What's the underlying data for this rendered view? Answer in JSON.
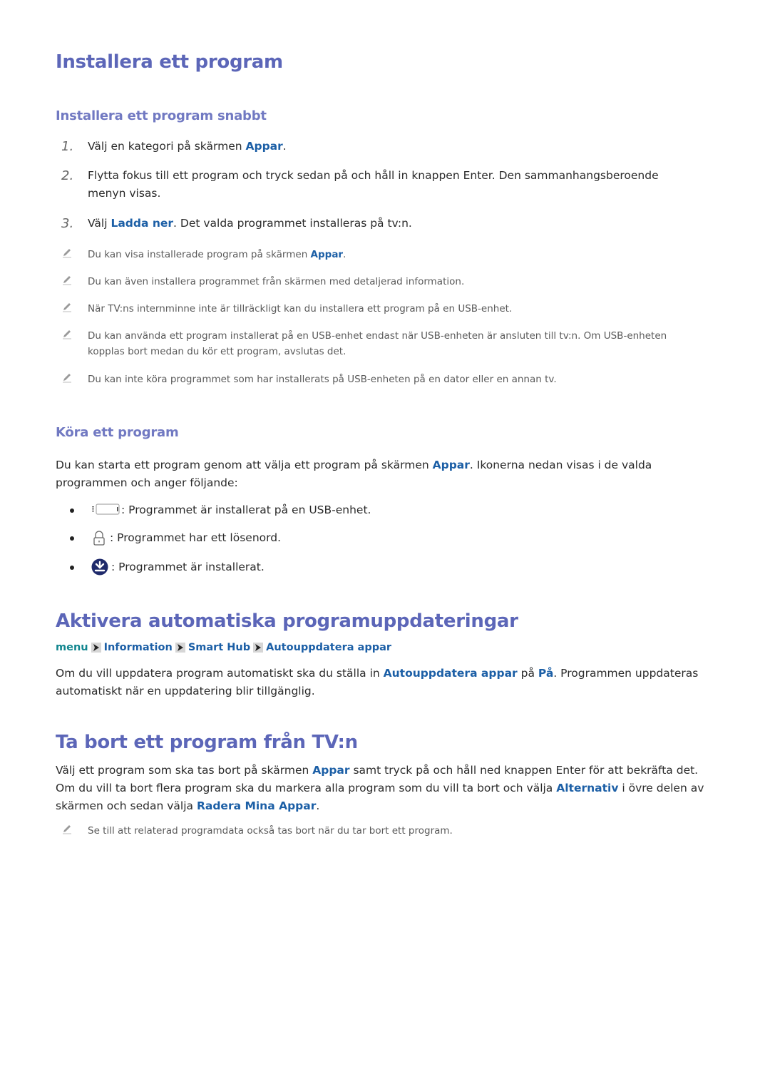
{
  "sections": {
    "install": {
      "title": "Installera ett program",
      "quick": {
        "title": "Installera ett program snabbt",
        "steps": [
          {
            "num": "1.",
            "pre": "Välj en kategori på skärmen ",
            "link": "Appar",
            "post": "."
          },
          {
            "num": "2.",
            "line1": "Flytta fokus till ett program och tryck sedan på och håll in knappen Enter. Den sammanhangsberoende",
            "line2": "menyn visas."
          },
          {
            "num": "3.",
            "pre": "Välj ",
            "link": "Ladda ner",
            "post": ". Det valda programmet installeras på tv:n."
          }
        ],
        "notes": [
          {
            "pre": "Du kan visa installerade program på skärmen ",
            "link": "Appar",
            "post": "."
          },
          {
            "text": "Du kan även installera programmet från skärmen med detaljerad information."
          },
          {
            "text": "När TV:ns internminne inte är tillräckligt kan du installera ett program på en USB-enhet."
          },
          {
            "line1": "Du kan använda ett program installerat på en USB-enhet endast när USB-enheten är ansluten till tv:n. Om USB-enheten",
            "line2": "kopplas bort medan du kör ett program, avslutas det."
          },
          {
            "text": "Du kan inte köra programmet som har installerats på USB-enheten på en dator eller en annan tv."
          }
        ]
      },
      "run": {
        "title": "Köra ett program",
        "para_pre": "Du kan starta ett program genom att välja ett program på skärmen ",
        "para_link": "Appar",
        "para_post": ". Ikonerna nedan visas i de valda",
        "para_line2": "programmen och anger följande:",
        "bullets": [
          {
            "icon": "usb-device-icon",
            "text": ": Programmet är installerat på en USB-enhet."
          },
          {
            "icon": "lock-icon",
            "text": ": Programmet har ett lösenord."
          },
          {
            "icon": "installed-download-icon",
            "text": ": Programmet är installerat."
          }
        ]
      }
    },
    "auto_update": {
      "title": "Aktivera automatiska programuppdateringar",
      "breadcrumb": [
        "menu",
        "Information",
        "Smart Hub",
        "Autouppdatera appar"
      ],
      "para_pre": "Om du vill uppdatera program automatiskt ska du ställa in ",
      "para_link1": "Autouppdatera appar",
      "para_mid": " på ",
      "para_link2": "På",
      "para_post": ". Programmen uppdateras",
      "para_line2": "automatiskt när en uppdatering blir tillgänglig."
    },
    "remove": {
      "title": "Ta bort ett program från TV:n",
      "l1_pre": "Välj ett program som ska tas bort på skärmen ",
      "l1_link": "Appar",
      "l1_post": " samt tryck på och håll ned knappen Enter för att bekräfta det.",
      "l2_pre": "Om du vill ta bort flera program ska du markera alla program som du vill ta bort och välja ",
      "l2_link": "Alternativ",
      "l2_post": " i övre delen av",
      "l3_pre": "skärmen och sedan välja ",
      "l3_link": "Radera Mina Appar",
      "l3_post": ".",
      "note": "Se till att relaterad programdata också tas bort när du tar bort ett program."
    }
  },
  "colors": {
    "heading": "#5c66b8",
    "subheading": "#7179c2",
    "link": "#1c5fa6",
    "menu_link": "#12868f",
    "note_text": "#5a5a5a",
    "body_text": "#2b2b2b"
  }
}
